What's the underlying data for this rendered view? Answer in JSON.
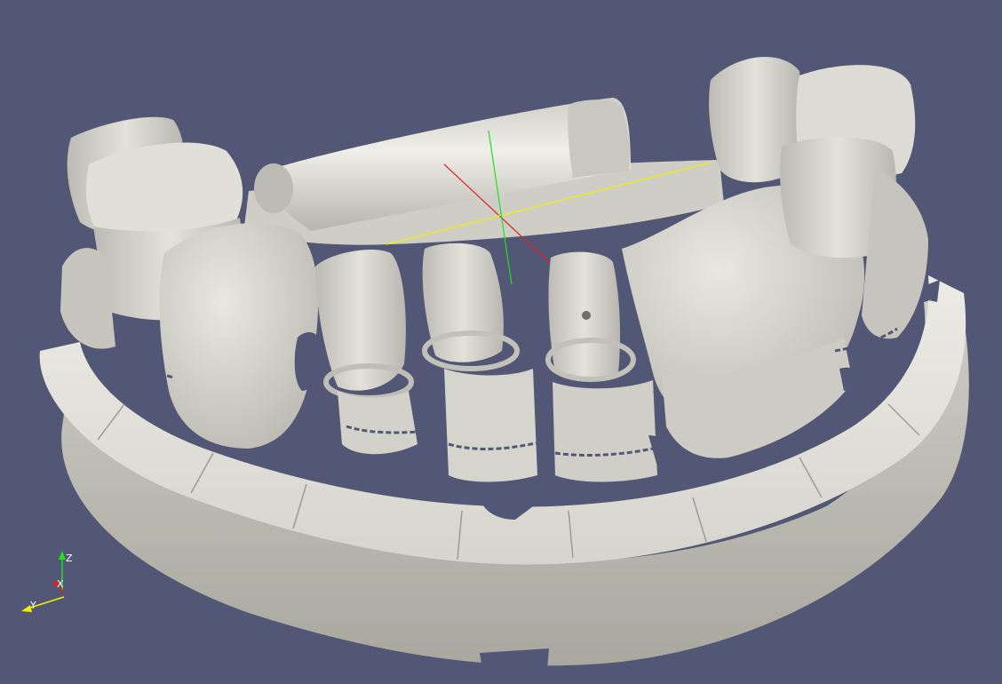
{
  "viewport": {
    "background_color": "#525775",
    "model_color": "#dcdbd3"
  },
  "center_axes": {
    "x_color": "#e02020",
    "y_color": "#f0f000",
    "z_color": "#20e020"
  },
  "orientation_axes": {
    "z_label": "Z",
    "y_label": "Y",
    "x_label": "X",
    "z_color": "#20e020",
    "y_color": "#f0f000",
    "x_color": "#e02020"
  }
}
